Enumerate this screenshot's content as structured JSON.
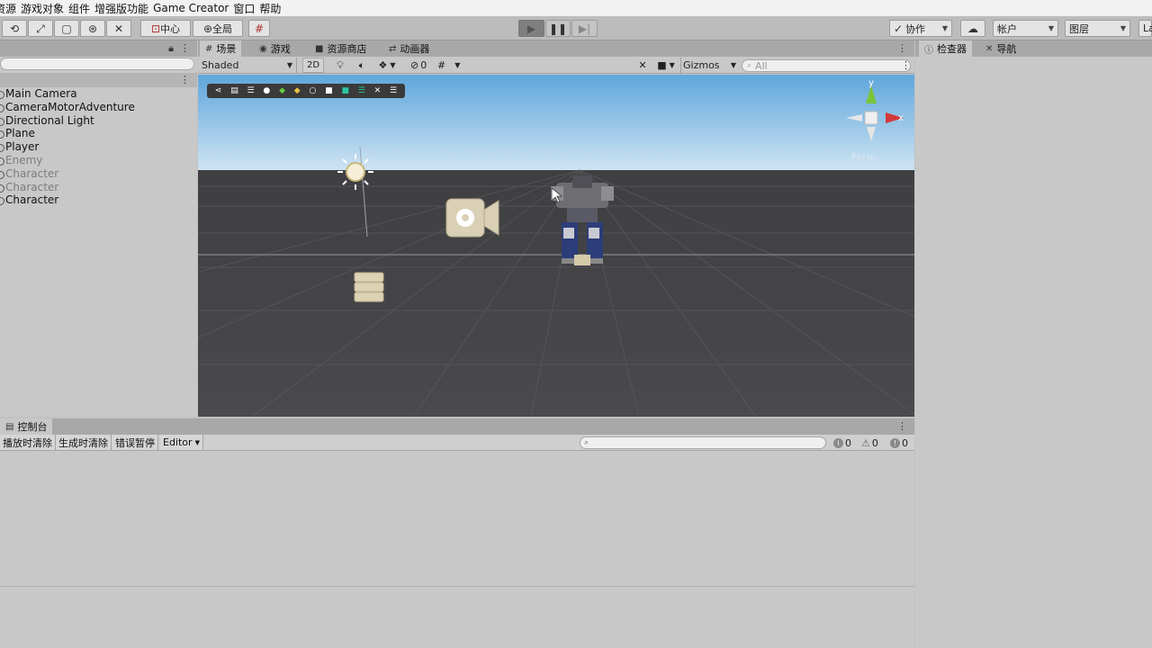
{
  "menubar": {
    "items": [
      "资源",
      "游戏对象",
      "组件",
      "增强版功能",
      "Game Creator",
      "窗口",
      "帮助"
    ]
  },
  "toolbar": {
    "pivot_label": "中心",
    "global_label": "全局",
    "collab_label": "协作",
    "account_label": "帐户",
    "layers_label": "图层",
    "layout_label": "La"
  },
  "hierarchy": {
    "items": [
      {
        "label": "Main Camera",
        "dim": false
      },
      {
        "label": "CameraMotorAdventure",
        "dim": false
      },
      {
        "label": "Directional Light",
        "dim": false
      },
      {
        "label": "Plane",
        "dim": false
      },
      {
        "label": "Player",
        "dim": false
      },
      {
        "label": "Enemy",
        "dim": true
      },
      {
        "label": "Character",
        "dim": true
      },
      {
        "label": "Character",
        "dim": true
      },
      {
        "label": "Character",
        "dim": false
      }
    ]
  },
  "scene": {
    "tabs": [
      "场景",
      "游戏",
      "资源商店",
      "动画器"
    ],
    "shading_mode": "Shaded",
    "mode_2d": "2D",
    "hidden_count": "0",
    "gizmos_label": "Gizmos",
    "search_placeholder": "All",
    "gizmo_axes": {
      "y": "y",
      "x": "x",
      "projection": "Persp"
    },
    "axis_colors": {
      "x": "#d43a3a",
      "y": "#7bc43a",
      "z": "#3a6fd4"
    }
  },
  "inspector": {
    "tabs": [
      "检查器",
      "导航"
    ]
  },
  "console": {
    "tab_label": "控制台",
    "buttons": [
      "播放时清除",
      "生成时清除",
      "错误暂停",
      "Editor"
    ],
    "counts": {
      "logs": "0",
      "warnings": "0",
      "errors": "0"
    }
  }
}
